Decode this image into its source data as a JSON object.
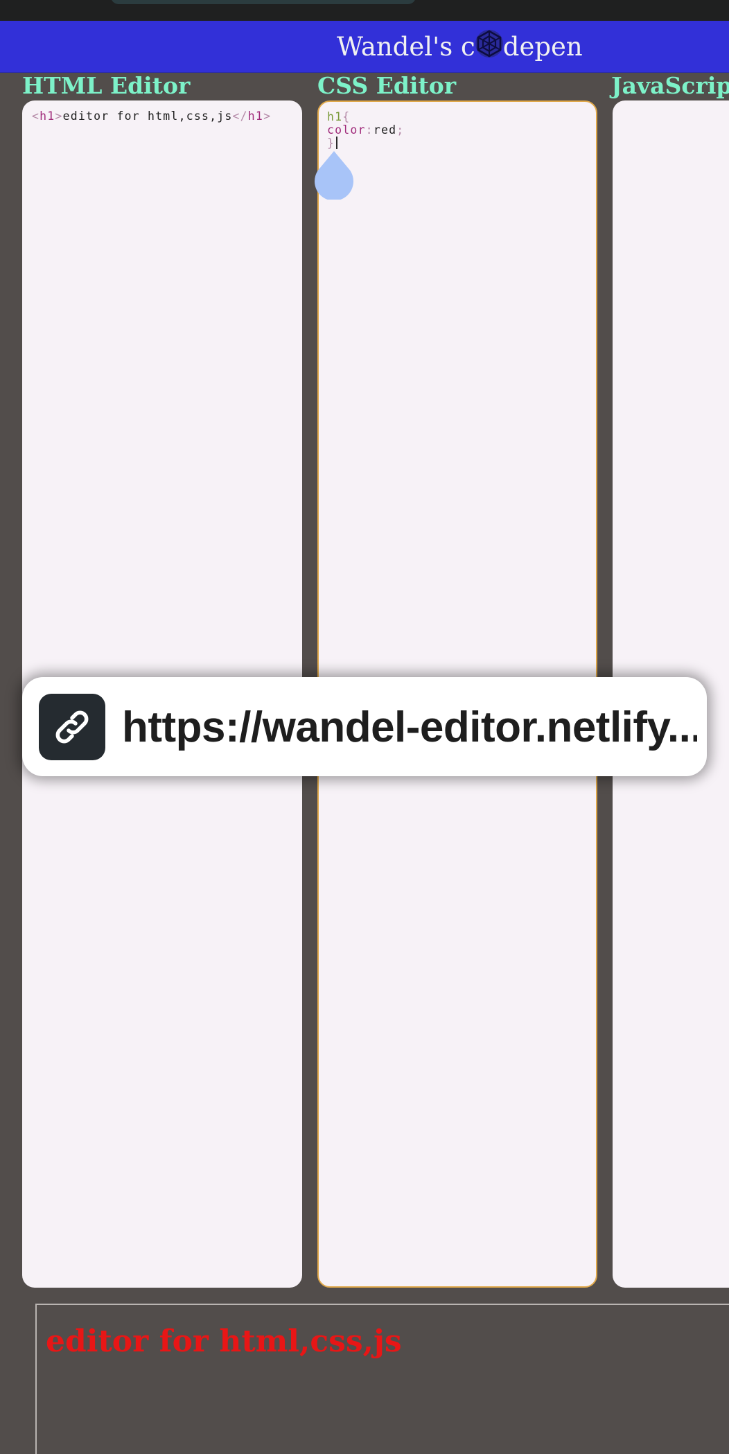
{
  "app": {
    "brand_before": "Wandel's c",
    "brand_after": "depen",
    "brand_logo_icon": "codepen-cube-icon"
  },
  "editors": {
    "html": {
      "title": "HTML Editor",
      "code": {
        "open_lt": "<",
        "open_tag": "h1",
        "open_gt": ">",
        "text": "editor for html,css,js",
        "close_lt": "</",
        "close_tag": "h1",
        "close_gt": ">"
      }
    },
    "css": {
      "title": "CSS Editor",
      "code": {
        "selector": "h1",
        "open_brace": "{",
        "property": "color",
        "colon": ":",
        "value": "red",
        "semicolon": ";",
        "close_brace": "}"
      }
    },
    "js": {
      "title": "JavaScript Editor"
    }
  },
  "share_toast": {
    "icon": "link-icon",
    "url_text": "https://wandel-editor.netlify..."
  },
  "preview": {
    "h1_text": "editor for html,css,js"
  },
  "colors": {
    "header_bg": "#3230d8",
    "editor_title": "#7df2c9",
    "page_bg": "#524d4b",
    "editor_bg": "#f7f2f7",
    "focus_border": "#e0a84a",
    "preview_text": "#e81616",
    "drop_handle": "#a8c4f8"
  }
}
